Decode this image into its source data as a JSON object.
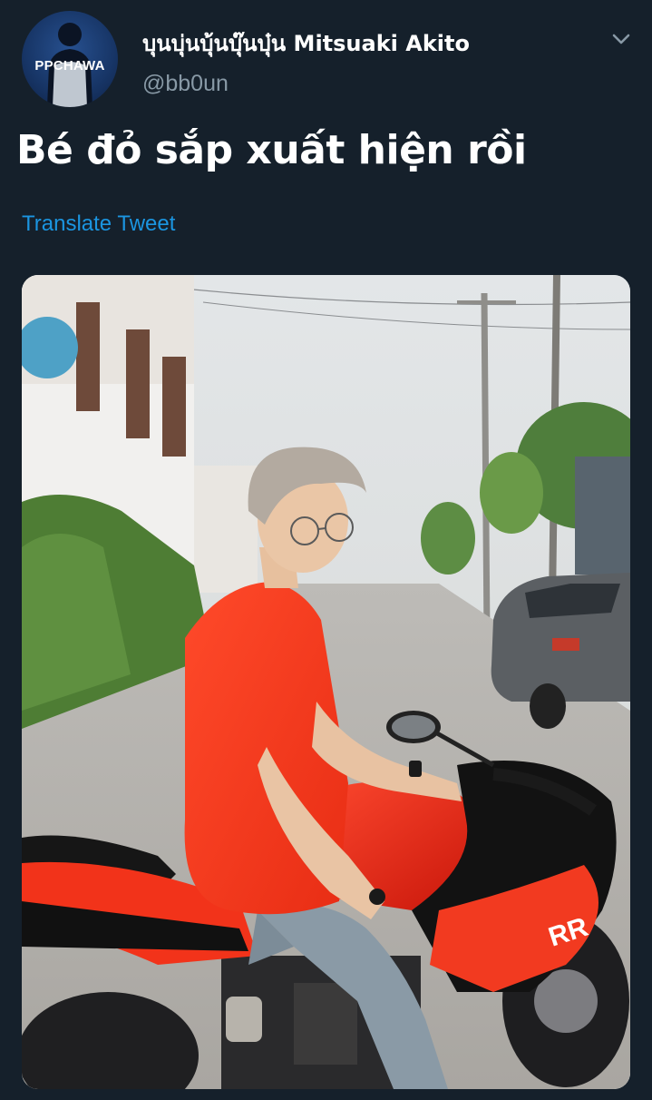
{
  "tweet": {
    "avatar_text": "PPCHAWA",
    "display_name": "บุนบุ่นบุ้นบุ๊นบุ๋น Mitsuaki Akito",
    "handle": "@bb0un",
    "text": "Bé đỏ sắp xuất hiện rồi",
    "translate_label": "Translate Tweet",
    "media_plate_text": "RR",
    "menu_icon": "chevron-down-icon"
  },
  "colors": {
    "background": "#15202b",
    "text_primary": "#ffffff",
    "text_secondary": "#8899a6",
    "link": "#1b95e0"
  }
}
